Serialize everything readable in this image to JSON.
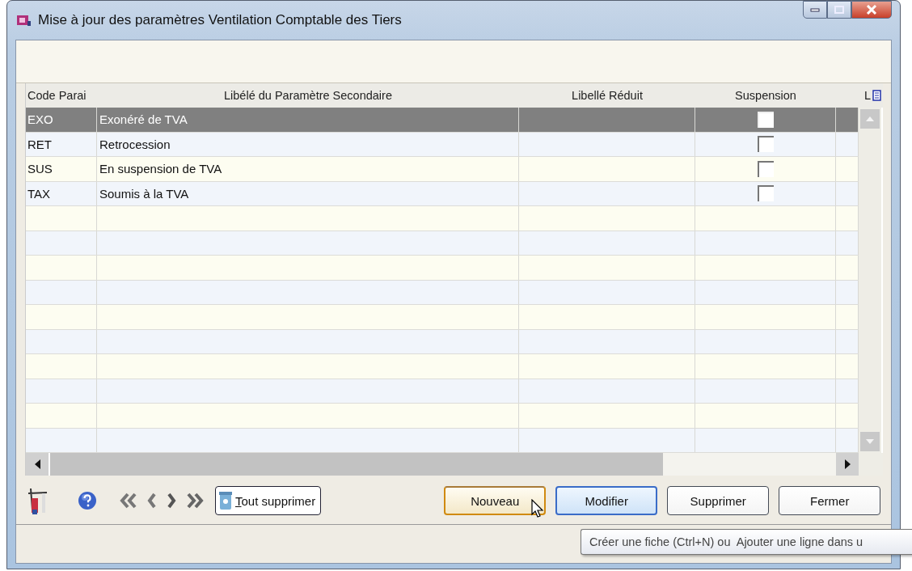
{
  "window": {
    "title": "Mise à jour des paramètres Ventilation Comptable des Tiers"
  },
  "table": {
    "columns": [
      "Code Parai",
      "Libélé du Paramètre Secondaire",
      "Libellé Réduit",
      "Suspension",
      "L"
    ],
    "rows": [
      {
        "code": "EXO",
        "label": "Exonéré de TVA",
        "short": "",
        "suspension": false,
        "selected": true
      },
      {
        "code": "RET",
        "label": "Retrocession",
        "short": "",
        "suspension": false,
        "selected": false
      },
      {
        "code": "SUS",
        "label": "En suspension de TVA",
        "short": "",
        "suspension": false,
        "selected": false
      },
      {
        "code": "TAX",
        "label": "Soumis à la TVA",
        "short": "",
        "suspension": false,
        "selected": false
      }
    ]
  },
  "toolbar": {
    "clear_all": "Tout supprimer"
  },
  "buttons": [
    {
      "label": "Nouveau",
      "kind": "hover"
    },
    {
      "label": "Modifier",
      "kind": "default"
    },
    {
      "label": "Supprimer",
      "kind": "normal"
    },
    {
      "label": "Fermer",
      "kind": "normal"
    }
  ],
  "tooltip": "Créer une fiche (Ctrl+N) ou  Ajouter une ligne dans u"
}
